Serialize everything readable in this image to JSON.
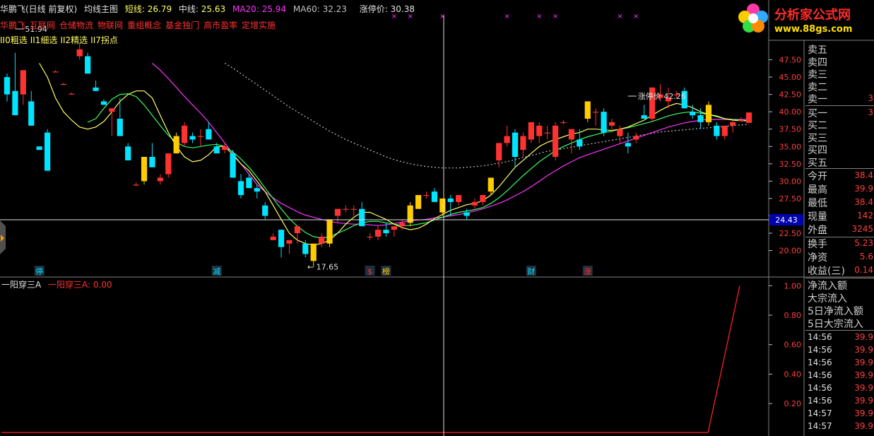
{
  "header": {
    "stock": "华鹏飞(日线 前复权)",
    "main": "均线主图",
    "ma_short_label": "短线:",
    "ma_short_value": "26.79",
    "ma_mid_label": "中线:",
    "ma_mid_value": "25.63",
    "ma20_label": "MA20:",
    "ma20_value": "25.94",
    "ma60_label": "MA60:",
    "ma60_value": "32.23",
    "limit_label": "涨停价:",
    "limit_value": "30.38"
  },
  "concepts": [
    "华鹏飞",
    "互联网",
    "仓储物流",
    "物联网",
    "重组概念",
    "基金独门",
    "高市盈率",
    "定增实施"
  ],
  "filters": [
    "II0粗选",
    "II1细选",
    "II2精选",
    "II7拐点"
  ],
  "colors": {
    "up": "#ff3232",
    "down": "#00e5ff",
    "special": "#ffcc00",
    "ma_short": "#ffff66",
    "ma_mid": "#33ff66",
    "ma20": "#ff33ff",
    "ma60": "#c0c0c0",
    "ind": "#ff2020"
  },
  "logo": {
    "text": "分析家公式网",
    "url": "www.88gs.com"
  },
  "price_panel": {
    "ask": [
      "卖五",
      "卖四",
      "卖三",
      "卖二",
      "卖一"
    ],
    "ask_one_value": "3",
    "bid": [
      "买一",
      "买二",
      "买三",
      "买四",
      "买五"
    ],
    "bid_one_value": "3",
    "stats": [
      {
        "label": "今开",
        "value": "38.4"
      },
      {
        "label": "最高",
        "value": "39.9"
      },
      {
        "label": "最低",
        "value": "38.4"
      },
      {
        "label": "现量",
        "value": "142"
      },
      {
        "label": "外盘",
        "value": "3245"
      },
      {
        "label": "换手",
        "value": "5.23"
      },
      {
        "label": "净资",
        "value": "5.6"
      },
      {
        "label": "收益(三)",
        "value": "0.14"
      }
    ],
    "flows": [
      "净流入额",
      "大宗流入",
      "5日净流入额",
      "5日大宗流入"
    ],
    "ticks": [
      {
        "time": "14:56",
        "price": "39.9"
      },
      {
        "time": "14:56",
        "price": "39.9"
      },
      {
        "time": "14:56",
        "price": "39.9"
      },
      {
        "time": "14:56",
        "price": "39.9"
      },
      {
        "time": "14:56",
        "price": "39.9"
      },
      {
        "time": "14:56",
        "price": "39.9"
      },
      {
        "time": "14:57",
        "price": "39.9"
      },
      {
        "time": "14:57",
        "price": "39.9"
      }
    ]
  },
  "indicator": {
    "name": "一阳穿三A",
    "series_label": "一阳穿三A:",
    "value": "0.00"
  },
  "chart_data": [
    {
      "type": "candlestick",
      "y_ticks": [
        20.0,
        22.5,
        25.0,
        27.5,
        30.0,
        32.5,
        35.0,
        37.5,
        40.0,
        42.5,
        45.0,
        47.5
      ],
      "y_tick_labels": [
        "20.00",
        "22.50",
        "",
        "27.50",
        "30.00",
        "32.50",
        "35.00",
        "37.50",
        "40.00",
        "42.50",
        "45.00",
        "47.50"
      ],
      "ylim": [
        17.0,
        50.0
      ],
      "crosshair_value": "24.43",
      "annotations": [
        {
          "text": "51.94",
          "index": 1,
          "value": 51.94
        },
        {
          "text": "17.65",
          "index": 36,
          "value": 17.65
        },
        {
          "text": "涨停价 42.26",
          "index": 77,
          "value": 42.26
        }
      ],
      "event_markers": [
        {
          "text": "停",
          "index": 4,
          "color": "#00e5ff"
        },
        {
          "text": "减",
          "index": 26,
          "color": "#00e5ff"
        },
        {
          "text": "$",
          "index": 45,
          "color": "#ff3030"
        },
        {
          "text": "榜",
          "index": 47,
          "color": "#ffcc00"
        },
        {
          "text": "财",
          "index": 65,
          "color": "#00e5ff"
        },
        {
          "text": "涨",
          "index": 72,
          "color": "#ff3030"
        }
      ],
      "top_marks": [
        48,
        50,
        54,
        62,
        66,
        68,
        76,
        78
      ],
      "candles": [
        [
          45.0,
          45.5,
          41.5,
          42.5
        ],
        [
          43.0,
          48.5,
          39.5,
          39.5
        ],
        [
          42.5,
          46.0,
          41.0,
          46.0
        ],
        [
          41.5,
          43.0,
          38.0,
          38.0
        ],
        [
          35.0,
          35.0,
          34.5,
          34.5
        ],
        [
          37.0,
          37.5,
          31.5,
          31.5
        ],
        [
          45.8,
          46.0,
          45.8,
          45.8
        ],
        [
          44.0,
          44.2,
          44.0,
          44.0
        ],
        [
          42.6,
          42.8,
          42.6,
          42.6
        ],
        [
          48.0,
          50.0,
          47.5,
          49.0
        ],
        [
          48.0,
          48.5,
          45.5,
          45.5
        ],
        [
          43.5,
          44.5,
          43.0,
          43.0
        ],
        [
          41.5,
          41.8,
          41.0,
          41.0
        ],
        [
          40.0,
          40.5,
          36.5,
          40.5
        ],
        [
          39.0,
          42.0,
          36.5,
          36.5
        ],
        [
          35.0,
          35.5,
          33.0,
          33.0
        ],
        [
          29.5,
          29.8,
          29.3,
          29.5
        ],
        [
          30.0,
          33.5,
          29.5,
          33.5
        ],
        [
          33.5,
          35.5,
          32.5,
          32.0
        ],
        [
          30.0,
          31.0,
          29.5,
          30.5
        ],
        [
          31.0,
          34.0,
          30.5,
          34.0
        ],
        [
          34.0,
          37.0,
          34.0,
          36.5
        ],
        [
          35.5,
          38.5,
          35.0,
          38.0
        ],
        [
          36.5,
          37.0,
          35.5,
          36.0
        ],
        [
          36.5,
          37.5,
          35.0,
          36.5
        ],
        [
          37.5,
          38.5,
          36.0,
          36.0
        ],
        [
          35.0,
          35.5,
          34.0,
          34.0
        ],
        [
          34.5,
          35.5,
          34.0,
          35.0
        ],
        [
          34.0,
          34.5,
          30.5,
          30.5
        ],
        [
          30.0,
          31.0,
          27.5,
          28.0
        ],
        [
          30.5,
          31.0,
          29.0,
          29.0
        ],
        [
          29.0,
          29.5,
          27.5,
          28.5
        ],
        [
          26.5,
          27.0,
          24.5,
          25.0
        ],
        [
          21.5,
          22.5,
          21.5,
          22.0
        ],
        [
          23.0,
          23.0,
          19.0,
          20.5
        ],
        [
          21.0,
          21.5,
          19.5,
          21.5
        ],
        [
          22.5,
          23.0,
          21.0,
          23.5
        ],
        [
          21.0,
          21.5,
          19.0,
          19.5
        ],
        [
          18.5,
          21.0,
          17.65,
          21.0
        ],
        [
          21.0,
          22.5,
          20.5,
          22.0
        ],
        [
          21.0,
          24.0,
          20.5,
          24.5
        ],
        [
          25.0,
          26.0,
          24.0,
          26.0
        ],
        [
          26.0,
          26.5,
          25.5,
          26.0
        ],
        [
          26.0,
          26.5,
          25.0,
          26.0
        ],
        [
          26.0,
          27.0,
          24.5,
          23.5
        ],
        [
          22.0,
          22.5,
          21.5,
          22.0
        ],
        [
          22.0,
          23.5,
          21.5,
          23.0
        ],
        [
          23.0,
          24.0,
          22.0,
          22.5
        ],
        [
          23.0,
          23.5,
          22.0,
          23.5
        ],
        [
          23.5,
          24.5,
          23.0,
          24.0
        ],
        [
          24.0,
          27.0,
          23.5,
          26.5
        ],
        [
          26.0,
          28.0,
          26.0,
          28.0
        ],
        [
          28.0,
          28.5,
          27.5,
          28.0
        ],
        [
          28.5,
          29.0,
          27.5,
          27.0
        ],
        [
          25.5,
          26.0,
          25.0,
          27.5
        ],
        [
          27.5,
          28.0,
          25.0,
          27.0
        ],
        [
          27.0,
          28.0,
          26.5,
          28.0
        ],
        [
          25.5,
          26.0,
          24.5,
          25.0
        ],
        [
          26.5,
          27.5,
          26.0,
          27.0
        ],
        [
          27.0,
          28.0,
          26.5,
          28.0
        ],
        [
          28.5,
          30.5,
          28.0,
          30.5
        ],
        [
          33.0,
          35.5,
          32.0,
          35.5
        ],
        [
          35.5,
          38.0,
          35.0,
          36.5
        ],
        [
          37.0,
          37.5,
          32.0,
          33.5
        ],
        [
          34.5,
          37.0,
          33.5,
          36.5
        ],
        [
          36.0,
          38.5,
          35.5,
          38.5
        ],
        [
          36.5,
          38.5,
          35.5,
          38.0
        ],
        [
          37.0,
          38.0,
          36.0,
          37.0
        ],
        [
          33.5,
          38.5,
          33.0,
          38.0
        ],
        [
          38.5,
          38.8,
          38.2,
          38.5
        ],
        [
          36.0,
          37.5,
          34.0,
          37.5
        ],
        [
          36.0,
          37.5,
          34.5,
          35.0
        ],
        [
          39.0,
          41.5,
          38.5,
          41.5
        ],
        [
          40.0,
          40.5,
          38.0,
          40.0
        ],
        [
          40.0,
          40.5,
          36.5,
          37.0
        ],
        [
          38.0,
          39.0,
          37.0,
          38.5
        ],
        [
          36.5,
          38.0,
          35.5,
          37.5
        ],
        [
          35.5,
          37.0,
          34.0,
          35.0
        ],
        [
          36.0,
          37.0,
          35.5,
          36.5
        ],
        [
          39.5,
          41.0,
          39.0,
          39.0
        ],
        [
          39.0,
          43.5,
          38.5,
          43.5
        ],
        [
          42.0,
          44.0,
          41.5,
          42.5
        ],
        [
          41.5,
          43.5,
          40.5,
          42.0
        ],
        [
          42.5,
          43.0,
          42.0,
          42.5
        ],
        [
          43.0,
          43.5,
          40.5,
          40.5
        ],
        [
          40.0,
          41.0,
          39.0,
          39.5
        ],
        [
          39.5,
          40.5,
          37.5,
          38.5
        ],
        [
          38.5,
          41.5,
          38.0,
          41.0
        ],
        [
          38.0,
          38.5,
          36.0,
          36.5
        ],
        [
          36.5,
          38.0,
          36.0,
          38.0
        ],
        [
          38.0,
          39.0,
          37.0,
          38.5
        ],
        [
          38.8,
          39.2,
          38.6,
          38.8
        ],
        [
          38.4,
          39.9,
          38.4,
          39.9
        ]
      ],
      "ma_short": [
        null,
        null,
        null,
        null,
        47.0,
        45.0,
        42.0,
        40.0,
        38.8,
        37.8,
        37.5,
        37.8,
        38.6,
        40.0,
        41.5,
        42.5,
        43.0,
        43.0,
        42.0,
        39.5,
        37.0,
        35.0,
        33.5,
        32.8,
        33.0,
        33.8,
        35.0,
        35.0,
        33.8,
        32.5,
        31.5,
        30.0,
        28.5,
        26.5,
        24.5,
        22.5,
        21.5,
        21.0,
        20.8,
        21.0,
        21.5,
        22.5,
        23.8,
        24.8,
        25.5,
        25.5,
        25.0,
        24.5,
        23.8,
        23.3,
        23.0,
        23.2,
        23.8,
        24.6,
        25.2,
        25.8,
        26.2,
        26.6,
        26.8,
        27.2,
        28.0,
        29.2,
        30.6,
        32.0,
        33.0,
        34.0,
        35.0,
        35.6,
        36.0,
        36.4,
        36.8,
        37.0,
        37.5,
        37.5,
        37.4,
        37.3,
        37.5,
        37.8,
        38.3,
        38.8,
        39.5,
        40.2,
        40.8,
        41.2,
        41.0,
        40.6,
        40.0,
        39.6,
        39.4,
        39.0,
        38.8,
        38.7,
        38.7
      ],
      "ma_mid": [
        null,
        null,
        null,
        null,
        null,
        null,
        null,
        null,
        null,
        null,
        38.5,
        39.0,
        40.5,
        41.8,
        42.5,
        42.6,
        42.2,
        41.0,
        39.5,
        38.0,
        36.6,
        35.6,
        35.0,
        34.8,
        35.0,
        35.2,
        35.3,
        35.0,
        34.2,
        33.2,
        32.0,
        30.6,
        29.0,
        27.5,
        26.0,
        24.6,
        23.5,
        22.6,
        22.0,
        21.8,
        22.0,
        22.5,
        23.0,
        23.6,
        24.0,
        24.2,
        24.2,
        24.0,
        23.8,
        23.6,
        23.6,
        23.8,
        24.0,
        24.4,
        24.8,
        25.2,
        25.5,
        25.7,
        25.9,
        26.2,
        26.8,
        27.6,
        28.6,
        29.7,
        30.8,
        31.8,
        32.8,
        33.6,
        34.4,
        35.0,
        35.5,
        36.0,
        36.4,
        36.7,
        37.0,
        37.2,
        37.5,
        37.7,
        38.0,
        38.3,
        38.6,
        39.0,
        39.4,
        39.7,
        39.9,
        40.0,
        39.8,
        39.6,
        39.3,
        39.0,
        38.9,
        38.8,
        38.7
      ],
      "ma20": [
        null,
        null,
        null,
        null,
        null,
        null,
        null,
        null,
        null,
        null,
        null,
        null,
        null,
        null,
        null,
        null,
        null,
        null,
        47.0,
        46.0,
        44.8,
        43.5,
        42.2,
        41.0,
        39.8,
        38.5,
        37.0,
        35.5,
        34.0,
        32.5,
        31.0,
        29.5,
        28.5,
        27.6,
        26.8,
        26.2,
        25.6,
        25.1,
        24.8,
        24.5,
        24.2,
        24.0,
        23.9,
        23.8,
        23.8,
        23.7,
        23.6,
        23.7,
        23.9,
        24.1,
        24.3,
        24.4,
        24.5,
        24.7,
        24.8,
        25.0,
        25.2,
        25.4,
        25.7,
        26.0,
        26.4,
        26.8,
        27.3,
        27.9,
        28.5,
        29.2,
        30.0,
        30.8,
        31.5,
        32.2,
        32.8,
        33.4,
        33.8,
        34.2,
        34.6,
        35.0,
        35.4,
        35.8,
        36.2,
        36.6,
        37.0,
        37.4,
        37.8,
        38.1,
        38.4,
        38.6,
        38.8,
        38.9,
        38.9,
        38.9,
        38.9,
        38.9,
        38.9
      ],
      "ma60": [
        null,
        null,
        null,
        null,
        null,
        null,
        null,
        null,
        null,
        null,
        null,
        null,
        null,
        null,
        null,
        null,
        null,
        null,
        null,
        null,
        null,
        null,
        null,
        null,
        null,
        null,
        null,
        47.0,
        46.3,
        45.5,
        44.7,
        43.9,
        43.1,
        42.3,
        41.5,
        40.7,
        40.0,
        39.3,
        38.6,
        37.9,
        37.2,
        36.6,
        36.0,
        35.5,
        35.0,
        34.5,
        34.0,
        33.5,
        33.1,
        32.8,
        32.5,
        32.3,
        32.1,
        32.0,
        31.9,
        31.9,
        31.9,
        32.0,
        32.1,
        32.2,
        32.4,
        32.6,
        32.8,
        33.1,
        33.4,
        33.7,
        34.0,
        34.3,
        34.5,
        34.7,
        34.9,
        35.1,
        35.3,
        35.5,
        35.7,
        35.9,
        36.1,
        36.3,
        36.5,
        36.7,
        36.9,
        37.1,
        37.2,
        37.3,
        37.4,
        37.5,
        37.6,
        37.7,
        37.8,
        37.9,
        38.0,
        38.1,
        38.2
      ]
    },
    {
      "type": "line",
      "name": "一阳穿三A",
      "y_ticks": [
        0.2,
        0.4,
        0.6,
        0.8,
        1.0
      ],
      "ylim": [
        -0.02,
        1.04
      ],
      "x_fraction": [
        0.0,
        0.957,
        1.0
      ],
      "values": [
        0.0,
        0.0,
        1.0
      ]
    }
  ]
}
